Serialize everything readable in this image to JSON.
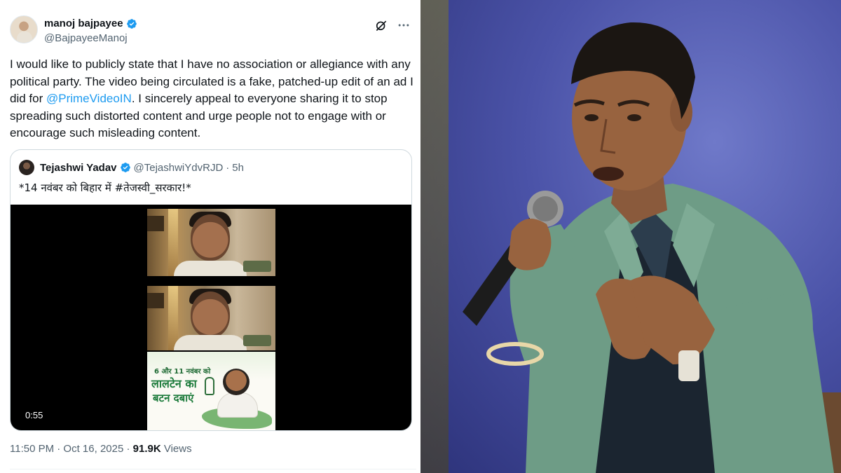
{
  "tweet": {
    "author": {
      "name": "manoj bajpayee",
      "handle": "@BajpayeeManoj",
      "verified": true,
      "verified_color": "#1d9bf0"
    },
    "header_icons": [
      "grok-icon",
      "more-options-icon"
    ],
    "body_before_mention": "I would like to publicly state that I have no association or allegiance with any political party. The video being circulated is a fake, patched-up edit of an ad I did for ",
    "mention": "@PrimeVideoIN",
    "body_after_mention": ". I sincerely appeal to everyone sharing it to stop spreading such distorted content and urge people not to engage with or encourage such misleading content.",
    "quote": {
      "name": "Tejashwi Yadav",
      "handle": "@TejashwiYdvRJD",
      "separator": "·",
      "time": "5h",
      "text": "*14 नवंबर को बिहार में #तेजस्वी_सरकार!*",
      "video": {
        "duration": "0:55",
        "poster_line1": "6 और 11 नवंबर को",
        "poster_line2": "लालटेन का",
        "poster_line3": "बटन दबाएं"
      }
    },
    "timestamp": "11:50 PM · Oct 16, 2025 · ",
    "views_count": "91.9K",
    "views_label": " Views",
    "colors": {
      "text": "#0f1419",
      "secondary": "#536471",
      "link": "#1d9bf0",
      "border": "#cfd9de"
    }
  },
  "photo": {
    "subject": "man speaking into a microphone",
    "background_color": "#4b53a8",
    "jacket_color": "#6f9f87"
  }
}
